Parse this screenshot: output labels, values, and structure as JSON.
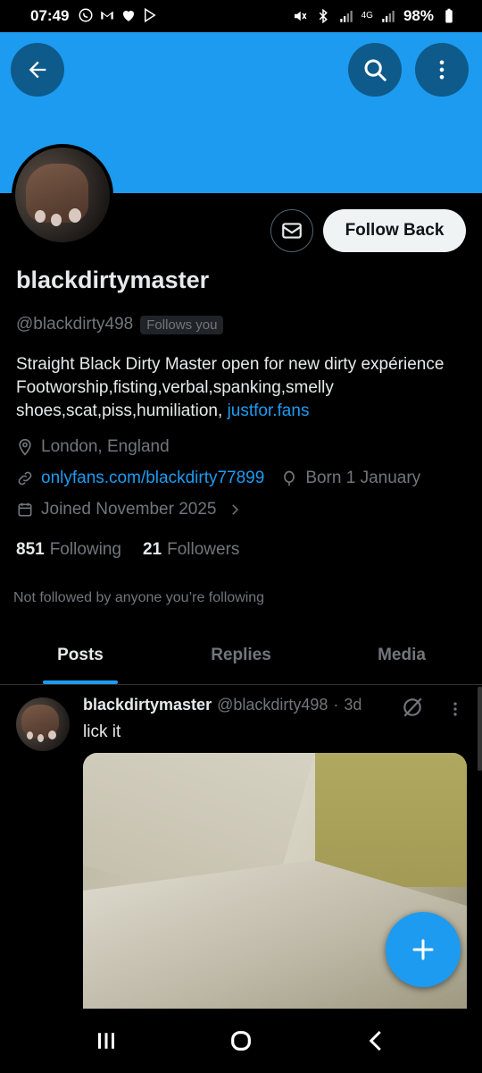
{
  "status_bar": {
    "time": "07:49",
    "battery": "98%",
    "network": "4G"
  },
  "header": {
    "back_icon": "arrow-left-icon",
    "search_icon": "search-icon",
    "more_icon": "more-vertical-icon",
    "banner_color": "#1d9bf0"
  },
  "profile": {
    "display_name": "blackdirtymaster",
    "handle": "@blackdirty498",
    "follows_you_badge": "Follows you",
    "follow_button": "Follow Back",
    "bio_text": "Straight Black Dirty Master open for new dirty expérience Footworship,fisting,verbal,spanking,smelly shoes,scat,piss,humiliation, ",
    "bio_link": "justfor.fans",
    "location": "London, England",
    "website": "onlyfans.com/blackdirty77899",
    "birthday": "Born 1 January",
    "joined": "Joined November 2025",
    "following_count": "851",
    "following_label": "Following",
    "followers_count": "21",
    "followers_label": "Followers",
    "mutuals_note": "Not followed by anyone you’re following"
  },
  "tabs": [
    {
      "label": "Posts",
      "active": true
    },
    {
      "label": "Replies",
      "active": false
    },
    {
      "label": "Media",
      "active": false
    }
  ],
  "post": {
    "author_name": "blackdirtymaster",
    "author_handle": "@blackdirty498",
    "separator": "·",
    "age": "3d",
    "text": "lick it"
  },
  "accent_color": "#1d9bf0"
}
